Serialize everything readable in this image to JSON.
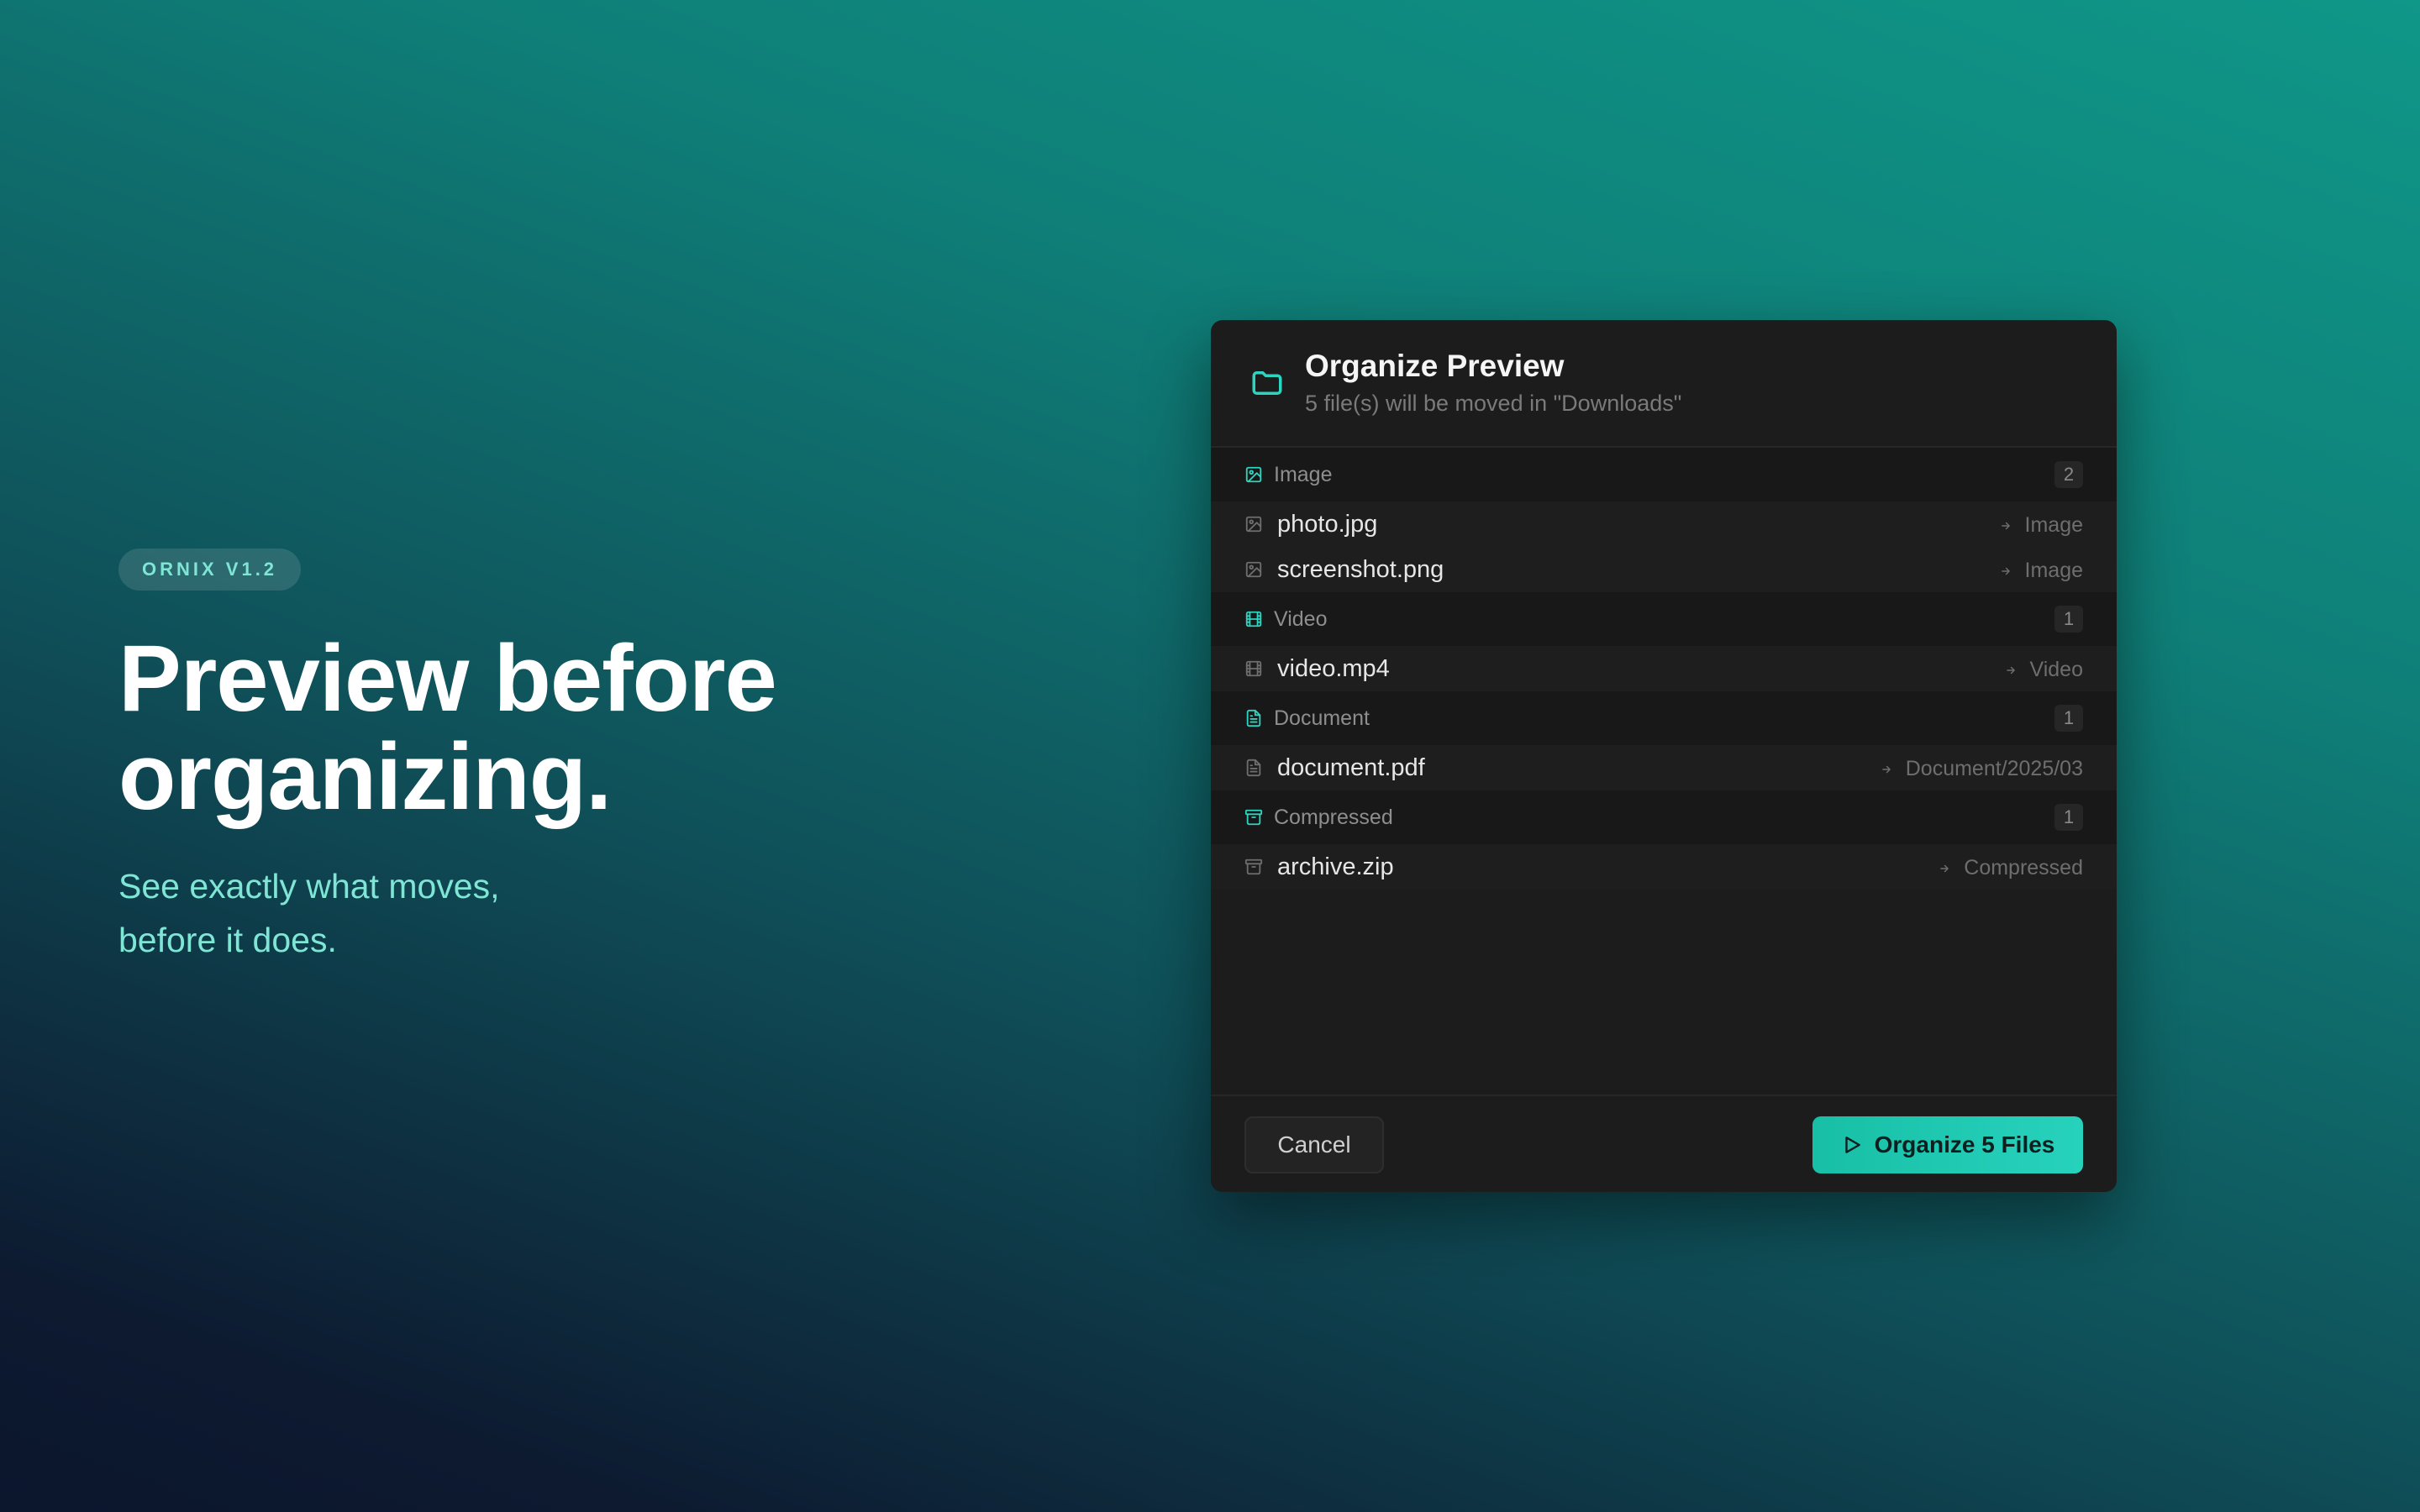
{
  "colors": {
    "accent": "#2dd4bf",
    "dialog_bg": "#1c1c1c",
    "badge_text": "#7fe6d6"
  },
  "hero": {
    "badge": "ORNIX V1.2",
    "headline_line1": "Preview before",
    "headline_line2": "organizing.",
    "sub_line1": "See exactly what moves,",
    "sub_line2": "before it does."
  },
  "dialog": {
    "icon": "folder-icon",
    "title": "Organize Preview",
    "subtitle": "5 file(s) will be moved in \"Downloads\"",
    "groups": [
      {
        "name": "Image",
        "icon": "image-icon",
        "count": "2",
        "files": [
          {
            "name": "photo.jpg",
            "dest": "Image"
          },
          {
            "name": "screenshot.png",
            "dest": "Image"
          }
        ]
      },
      {
        "name": "Video",
        "icon": "film-icon",
        "count": "1",
        "files": [
          {
            "name": "video.mp4",
            "dest": "Video"
          }
        ]
      },
      {
        "name": "Document",
        "icon": "document-icon",
        "count": "1",
        "files": [
          {
            "name": "document.pdf",
            "dest": "Document/2025/03"
          }
        ]
      },
      {
        "name": "Compressed",
        "icon": "archive-icon",
        "count": "1",
        "files": [
          {
            "name": "archive.zip",
            "dest": "Compressed"
          }
        ]
      }
    ],
    "cancel_label": "Cancel",
    "organize_label": "Organize 5 Files"
  }
}
